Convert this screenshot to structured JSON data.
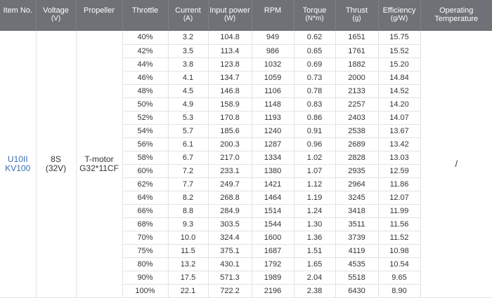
{
  "headers": [
    {
      "label": "Item No.",
      "unit": ""
    },
    {
      "label": "Voltage",
      "unit": "(V)"
    },
    {
      "label": "Propeller",
      "unit": ""
    },
    {
      "label": "Throttle",
      "unit": ""
    },
    {
      "label": "Current",
      "unit": "(A)"
    },
    {
      "label": "Input power",
      "unit": "(W)"
    },
    {
      "label": "RPM",
      "unit": ""
    },
    {
      "label": "Torque",
      "unit": "(N*m)"
    },
    {
      "label": "Thrust",
      "unit": "(g)"
    },
    {
      "label": "Efficiency",
      "unit": "(g/W)"
    },
    {
      "label": "Operating Temperature",
      "unit": ""
    }
  ],
  "item": {
    "line1": "U10II",
    "line2": "KV100"
  },
  "voltage": {
    "line1": "8S",
    "line2": "(32V)"
  },
  "propeller": {
    "line1": "T-motor",
    "line2": "G32*11CF"
  },
  "temperature": "/",
  "colors": {
    "header_bg": "#6e7176",
    "header_text": "#ffffff",
    "item_text": "#3b6fb0",
    "grid": "#e1e3e6"
  },
  "rows": [
    [
      "40%",
      "3.2",
      "104.8",
      "949",
      "0.62",
      "1651",
      "15.75"
    ],
    [
      "42%",
      "3.5",
      "113.4",
      "986",
      "0.65",
      "1761",
      "15.52"
    ],
    [
      "44%",
      "3.8",
      "123.8",
      "1032",
      "0.69",
      "1882",
      "15.20"
    ],
    [
      "46%",
      "4.1",
      "134.7",
      "1059",
      "0.73",
      "2000",
      "14.84"
    ],
    [
      "48%",
      "4.5",
      "146.8",
      "1106",
      "0.78",
      "2133",
      "14.52"
    ],
    [
      "50%",
      "4.9",
      "158.9",
      "1148",
      "0.83",
      "2257",
      "14.20"
    ],
    [
      "52%",
      "5.3",
      "170.8",
      "1193",
      "0.86",
      "2403",
      "14.07"
    ],
    [
      "54%",
      "5.7",
      "185.6",
      "1240",
      "0.91",
      "2538",
      "13.67"
    ],
    [
      "56%",
      "6.1",
      "200.3",
      "1287",
      "0.96",
      "2689",
      "13.42"
    ],
    [
      "58%",
      "6.7",
      "217.0",
      "1334",
      "1.02",
      "2828",
      "13.03"
    ],
    [
      "60%",
      "7.2",
      "233.1",
      "1380",
      "1.07",
      "2935",
      "12.59"
    ],
    [
      "62%",
      "7.7",
      "249.7",
      "1421",
      "1.12",
      "2964",
      "11.86"
    ],
    [
      "64%",
      "8.2",
      "268.8",
      "1464",
      "1.19",
      "3245",
      "12.07"
    ],
    [
      "66%",
      "8.8",
      "284.9",
      "1514",
      "1.24",
      "3418",
      "11.99"
    ],
    [
      "68%",
      "9.3",
      "303.5",
      "1544",
      "1.30",
      "3511",
      "11.56"
    ],
    [
      "70%",
      "10.0",
      "324.4",
      "1600",
      "1.36",
      "3739",
      "11.52"
    ],
    [
      "75%",
      "11.5",
      "375.1",
      "1687",
      "1.51",
      "4119",
      "10.98"
    ],
    [
      "80%",
      "13.2",
      "430.1",
      "1792",
      "1.65",
      "4535",
      "10.54"
    ],
    [
      "90%",
      "17.5",
      "571.3",
      "1989",
      "2.04",
      "5518",
      "9.65"
    ],
    [
      "100%",
      "22.1",
      "722.2",
      "2196",
      "2.38",
      "6430",
      "8.90"
    ]
  ]
}
